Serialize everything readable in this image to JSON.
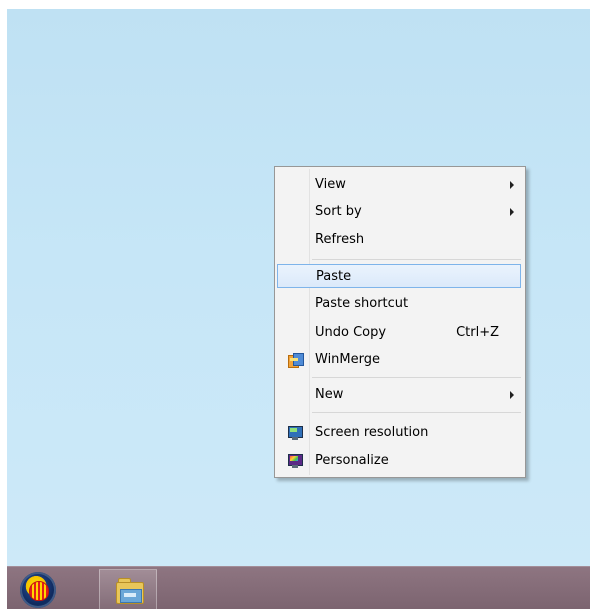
{
  "context_menu": {
    "view": "View",
    "sort_by": "Sort by",
    "refresh": "Refresh",
    "paste": "Paste",
    "paste_shortcut": "Paste shortcut",
    "undo_copy": "Undo Copy",
    "undo_copy_shortcut": "Ctrl+Z",
    "winmerge": "WinMerge",
    "new": "New",
    "screen_resolution": "Screen resolution",
    "personalize": "Personalize"
  },
  "icons": {
    "start": "start-orb-shell-icon",
    "taskbar_app": "file-explorer-folder-icon",
    "winmerge": "winmerge-icon",
    "screen_resolution": "screen-resolution-monitor-icon",
    "personalize": "personalize-monitor-icon"
  },
  "colors": {
    "desktop": "#c4e4f6",
    "taskbar": "#857079",
    "menu_bg": "#f3f3f3",
    "highlight_border": "#7eb4ea"
  }
}
